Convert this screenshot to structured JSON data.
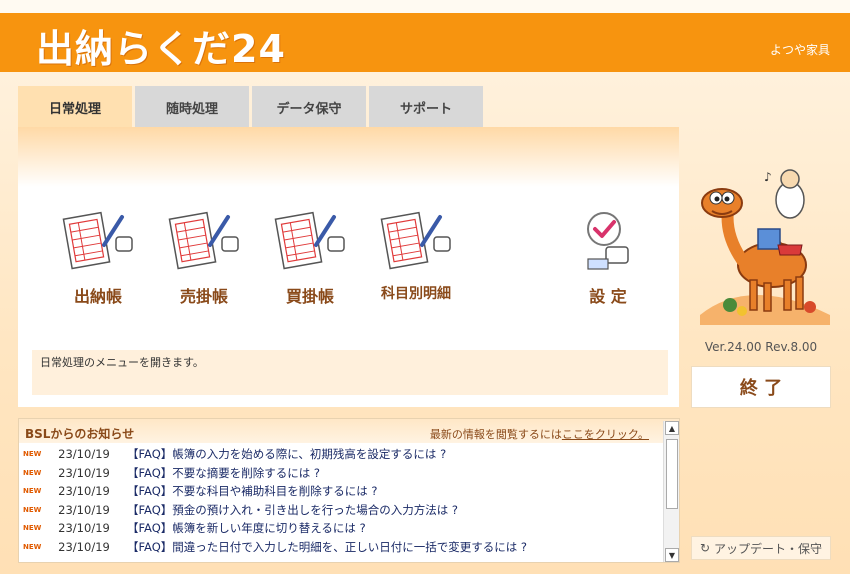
{
  "app": {
    "title": "出納らくだ24",
    "company": "よつや家具",
    "version": "Ver.24.00  Rev.8.00"
  },
  "tabs": [
    {
      "label": "日常処理",
      "active": true
    },
    {
      "label": "随時処理",
      "active": false
    },
    {
      "label": "データ保守",
      "active": false
    },
    {
      "label": "サポート",
      "active": false
    }
  ],
  "menu": {
    "items": [
      {
        "label": "出納帳",
        "icon": "ledger-form-icon"
      },
      {
        "label": "売掛帳",
        "icon": "ledger-form-icon"
      },
      {
        "label": "買掛帳",
        "icon": "ledger-form-icon"
      },
      {
        "label": "科目別明細",
        "icon": "ledger-form-icon"
      }
    ],
    "settings_label": "設 定"
  },
  "status": {
    "message": "日常処理のメニューを開きます。"
  },
  "news": {
    "title": "BSLからのお知らせ",
    "link_prefix": "最新の情報を閲覧するには",
    "link_text": "ここをクリック。",
    "new_badge": "NEW",
    "items": [
      {
        "date": "23/10/19",
        "text": "【FAQ】帳簿の入力を始める際に、初期残高を設定するには ?"
      },
      {
        "date": "23/10/19",
        "text": "【FAQ】不要な摘要を削除するには ?"
      },
      {
        "date": "23/10/19",
        "text": "【FAQ】不要な科目や補助科目を削除するには ?"
      },
      {
        "date": "23/10/19",
        "text": "【FAQ】預金の預け入れ・引き出しを行った場合の入力方法は ?"
      },
      {
        "date": "23/10/19",
        "text": "【FAQ】帳簿を新しい年度に切り替えるには ?"
      },
      {
        "date": "23/10/19",
        "text": "【FAQ】間違った日付で入力した明細を、正しい日付に一括で変更するには ?"
      }
    ]
  },
  "buttons": {
    "exit": "終 了",
    "update": "アップデート・保守"
  },
  "colors": {
    "brand_orange": "#f7940f",
    "label_brown": "#8a4a1a",
    "link_navy": "#1a2a66"
  }
}
